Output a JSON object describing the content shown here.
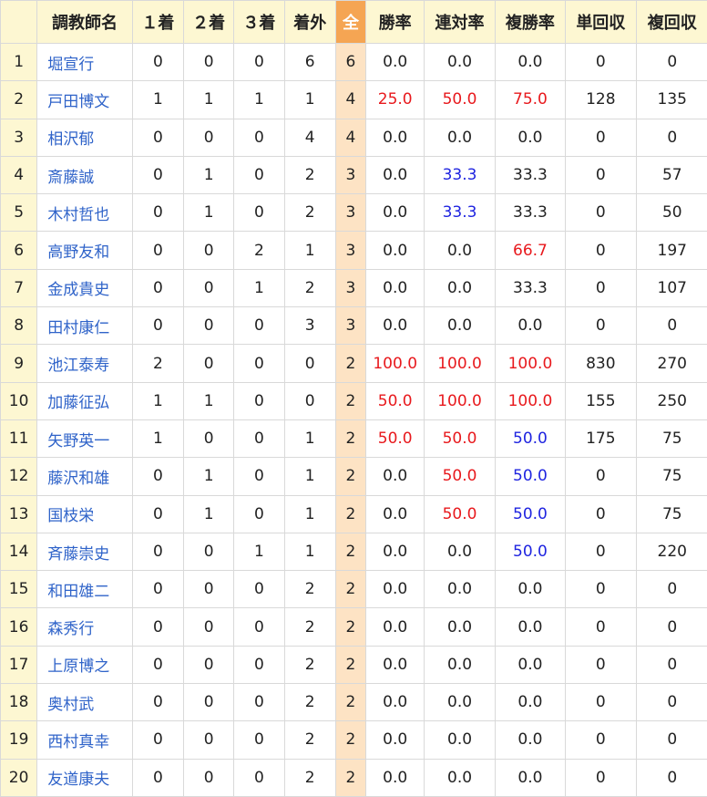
{
  "headers": [
    "",
    "調教師名",
    "１着",
    "２着",
    "３着",
    "着外",
    "全",
    "勝率",
    "連対率",
    "複勝率",
    "単回収",
    "複回収"
  ],
  "rows": [
    {
      "rank": "1",
      "name": "堀宣行",
      "first": "0",
      "second": "0",
      "third": "0",
      "out": "6",
      "total": "6",
      "win_rate": "0.0",
      "quinella_rate": "0.0",
      "show_rate": "0.0",
      "win_return": "0",
      "show_return": "0"
    },
    {
      "rank": "2",
      "name": "戸田博文",
      "first": "1",
      "second": "1",
      "third": "1",
      "out": "1",
      "total": "4",
      "win_rate": "25.0",
      "quinella_rate": "50.0",
      "show_rate": "75.0",
      "win_return": "128",
      "show_return": "135"
    },
    {
      "rank": "3",
      "name": "相沢郁",
      "first": "0",
      "second": "0",
      "third": "0",
      "out": "4",
      "total": "4",
      "win_rate": "0.0",
      "quinella_rate": "0.0",
      "show_rate": "0.0",
      "win_return": "0",
      "show_return": "0"
    },
    {
      "rank": "4",
      "name": "斎藤誠",
      "first": "0",
      "second": "1",
      "third": "0",
      "out": "2",
      "total": "3",
      "win_rate": "0.0",
      "quinella_rate": "33.3",
      "show_rate": "33.3",
      "win_return": "0",
      "show_return": "57"
    },
    {
      "rank": "5",
      "name": "木村哲也",
      "first": "0",
      "second": "1",
      "third": "0",
      "out": "2",
      "total": "3",
      "win_rate": "0.0",
      "quinella_rate": "33.3",
      "show_rate": "33.3",
      "win_return": "0",
      "show_return": "50"
    },
    {
      "rank": "6",
      "name": "高野友和",
      "first": "0",
      "second": "0",
      "third": "2",
      "out": "1",
      "total": "3",
      "win_rate": "0.0",
      "quinella_rate": "0.0",
      "show_rate": "66.7",
      "win_return": "0",
      "show_return": "197"
    },
    {
      "rank": "7",
      "name": "金成貴史",
      "first": "0",
      "second": "0",
      "third": "1",
      "out": "2",
      "total": "3",
      "win_rate": "0.0",
      "quinella_rate": "0.0",
      "show_rate": "33.3",
      "win_return": "0",
      "show_return": "107"
    },
    {
      "rank": "8",
      "name": "田村康仁",
      "first": "0",
      "second": "0",
      "third": "0",
      "out": "3",
      "total": "3",
      "win_rate": "0.0",
      "quinella_rate": "0.0",
      "show_rate": "0.0",
      "win_return": "0",
      "show_return": "0"
    },
    {
      "rank": "9",
      "name": "池江泰寿",
      "first": "2",
      "second": "0",
      "third": "0",
      "out": "0",
      "total": "2",
      "win_rate": "100.0",
      "quinella_rate": "100.0",
      "show_rate": "100.0",
      "win_return": "830",
      "show_return": "270"
    },
    {
      "rank": "10",
      "name": "加藤征弘",
      "first": "1",
      "second": "1",
      "third": "0",
      "out": "0",
      "total": "2",
      "win_rate": "50.0",
      "quinella_rate": "100.0",
      "show_rate": "100.0",
      "win_return": "155",
      "show_return": "250"
    },
    {
      "rank": "11",
      "name": "矢野英一",
      "first": "1",
      "second": "0",
      "third": "0",
      "out": "1",
      "total": "2",
      "win_rate": "50.0",
      "quinella_rate": "50.0",
      "show_rate": "50.0",
      "win_return": "175",
      "show_return": "75"
    },
    {
      "rank": "12",
      "name": "藤沢和雄",
      "first": "0",
      "second": "1",
      "third": "0",
      "out": "1",
      "total": "2",
      "win_rate": "0.0",
      "quinella_rate": "50.0",
      "show_rate": "50.0",
      "win_return": "0",
      "show_return": "75"
    },
    {
      "rank": "13",
      "name": "国枝栄",
      "first": "0",
      "second": "1",
      "third": "0",
      "out": "1",
      "total": "2",
      "win_rate": "0.0",
      "quinella_rate": "50.0",
      "show_rate": "50.0",
      "win_return": "0",
      "show_return": "75"
    },
    {
      "rank": "14",
      "name": "斉藤崇史",
      "first": "0",
      "second": "0",
      "third": "1",
      "out": "1",
      "total": "2",
      "win_rate": "0.0",
      "quinella_rate": "0.0",
      "show_rate": "50.0",
      "win_return": "0",
      "show_return": "220"
    },
    {
      "rank": "15",
      "name": "和田雄二",
      "first": "0",
      "second": "0",
      "third": "0",
      "out": "2",
      "total": "2",
      "win_rate": "0.0",
      "quinella_rate": "0.0",
      "show_rate": "0.0",
      "win_return": "0",
      "show_return": "0"
    },
    {
      "rank": "16",
      "name": "森秀行",
      "first": "0",
      "second": "0",
      "third": "0",
      "out": "2",
      "total": "2",
      "win_rate": "0.0",
      "quinella_rate": "0.0",
      "show_rate": "0.0",
      "win_return": "0",
      "show_return": "0"
    },
    {
      "rank": "17",
      "name": "上原博之",
      "first": "0",
      "second": "0",
      "third": "0",
      "out": "2",
      "total": "2",
      "win_rate": "0.0",
      "quinella_rate": "0.0",
      "show_rate": "0.0",
      "win_return": "0",
      "show_return": "0"
    },
    {
      "rank": "18",
      "name": "奥村武",
      "first": "0",
      "second": "0",
      "third": "0",
      "out": "2",
      "total": "2",
      "win_rate": "0.0",
      "quinella_rate": "0.0",
      "show_rate": "0.0",
      "win_return": "0",
      "show_return": "0"
    },
    {
      "rank": "19",
      "name": "西村真幸",
      "first": "0",
      "second": "0",
      "third": "0",
      "out": "2",
      "total": "2",
      "win_rate": "0.0",
      "quinella_rate": "0.0",
      "show_rate": "0.0",
      "win_return": "0",
      "show_return": "0"
    },
    {
      "rank": "20",
      "name": "友道康夫",
      "first": "0",
      "second": "0",
      "third": "0",
      "out": "2",
      "total": "2",
      "win_rate": "0.0",
      "quinella_rate": "0.0",
      "show_rate": "0.0",
      "win_return": "0",
      "show_return": "0"
    }
  ],
  "colors": {
    "header_bg": "#fdf7d2",
    "total_header_bg": "#f5a553",
    "total_cell_bg": "#fde3c4",
    "link": "#2f63c9",
    "high_rate": "#e8191d",
    "mid_rate": "#1f24e0"
  }
}
